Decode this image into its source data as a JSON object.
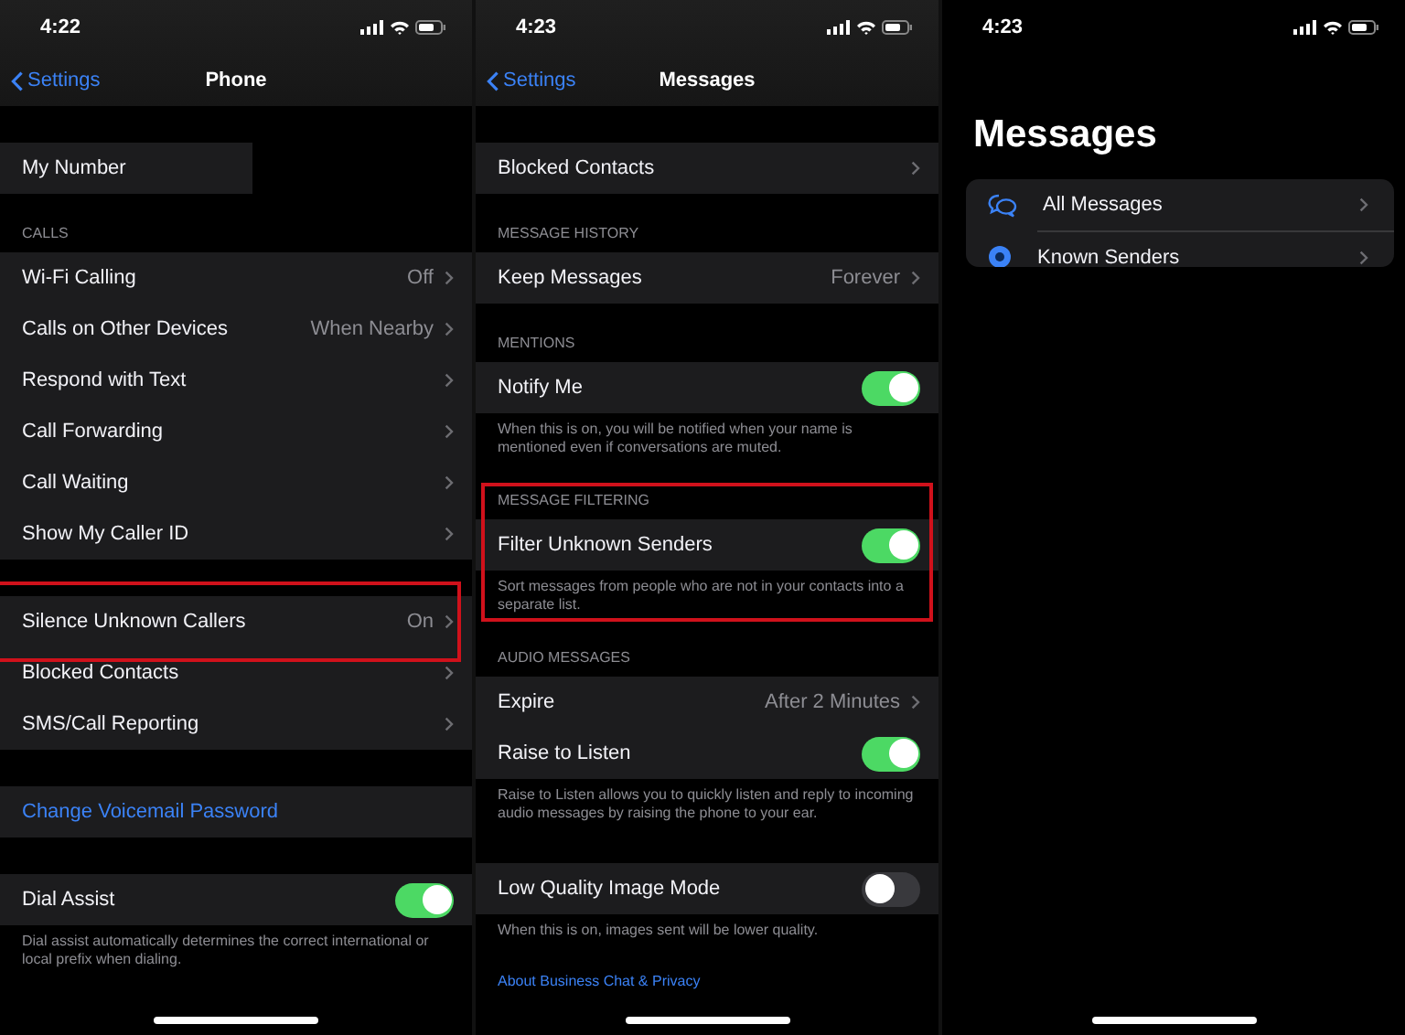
{
  "panels": [
    {
      "kind": "settings",
      "status": {
        "time": "4:22"
      },
      "nav": {
        "back": "Settings",
        "title": "Phone"
      },
      "sections": [
        {
          "highlighted": false,
          "rows": [
            {
              "kind": "redacted",
              "label": "My Number",
              "highlighted": false
            }
          ]
        },
        {
          "header": "CALLS",
          "highlighted": false,
          "rows": [
            {
              "kind": "link",
              "label": "Wi-Fi Calling",
              "value": "Off",
              "highlighted": false
            },
            {
              "kind": "link",
              "label": "Calls on Other Devices",
              "value": "When Nearby",
              "highlighted": false
            },
            {
              "kind": "link",
              "label": "Respond with Text",
              "highlighted": false
            },
            {
              "kind": "link",
              "label": "Call Forwarding",
              "highlighted": false
            },
            {
              "kind": "link",
              "label": "Call Waiting",
              "highlighted": false
            },
            {
              "kind": "link",
              "label": "Show My Caller ID",
              "highlighted": false
            }
          ]
        },
        {
          "highlighted": false,
          "rows": [
            {
              "kind": "link",
              "label": "Silence Unknown Callers",
              "value": "On",
              "highlighted": true
            },
            {
              "kind": "link",
              "label": "Blocked Contacts",
              "highlighted": false
            },
            {
              "kind": "link",
              "label": "SMS/Call Reporting",
              "highlighted": false
            }
          ]
        },
        {
          "highlighted": false,
          "rows": [
            {
              "kind": "action",
              "label": "Change Voicemail Password",
              "highlighted": false
            }
          ]
        },
        {
          "highlighted": false,
          "rows": [
            {
              "kind": "toggle",
              "label": "Dial Assist",
              "on": true,
              "highlighted": false
            }
          ],
          "footer": "Dial assist automatically determines the correct international or local prefix when dialing."
        }
      ]
    },
    {
      "kind": "settings",
      "status": {
        "time": "4:23"
      },
      "nav": {
        "back": "Settings",
        "title": "Messages"
      },
      "sections": [
        {
          "highlighted": false,
          "rows": [
            {
              "kind": "link",
              "label": "Blocked Contacts",
              "highlighted": false
            }
          ]
        },
        {
          "header": "MESSAGE HISTORY",
          "highlighted": false,
          "rows": [
            {
              "kind": "link",
              "label": "Keep Messages",
              "value": "Forever",
              "highlighted": false
            }
          ]
        },
        {
          "header": "MENTIONS",
          "highlighted": false,
          "rows": [
            {
              "kind": "toggle",
              "label": "Notify Me",
              "on": true,
              "highlighted": false
            }
          ],
          "footer": "When this is on, you will be notified when your name is mentioned even if conversations are muted."
        },
        {
          "header": "MESSAGE FILTERING",
          "highlighted": true,
          "rows": [
            {
              "kind": "toggle",
              "label": "Filter Unknown Senders",
              "on": true,
              "highlighted": false
            }
          ],
          "footer": "Sort messages from people who are not in your contacts into a separate list."
        },
        {
          "header": "AUDIO MESSAGES",
          "highlighted": false,
          "rows": [
            {
              "kind": "link",
              "label": "Expire",
              "value": "After 2 Minutes",
              "highlighted": false
            },
            {
              "kind": "toggle",
              "label": "Raise to Listen",
              "on": true,
              "highlighted": false
            }
          ],
          "footer": "Raise to Listen allows you to quickly listen and reply to incoming audio messages by raising the phone to your ear."
        },
        {
          "highlighted": false,
          "rows": [
            {
              "kind": "toggle",
              "label": "Low Quality Image Mode",
              "on": false,
              "highlighted": false
            }
          ],
          "footer": "When this is on, images sent will be lower quality."
        }
      ],
      "footer_link": "About Business Chat & Privacy"
    },
    {
      "kind": "list",
      "status": {
        "time": "4:23"
      },
      "title": "Messages",
      "filters": [
        {
          "kind": "bubbles",
          "label": "All Messages"
        },
        {
          "kind": "person",
          "label": "Known Senders"
        }
      ]
    }
  ]
}
